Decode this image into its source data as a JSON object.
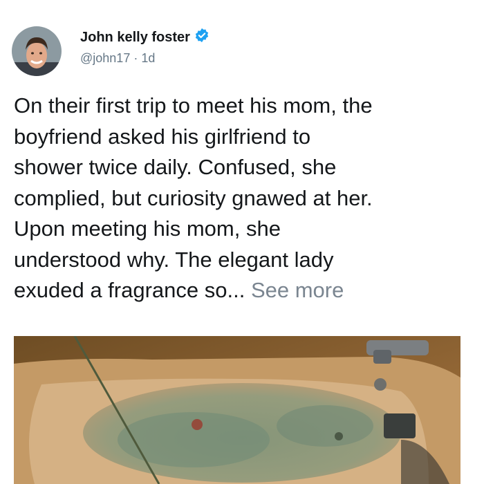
{
  "author": {
    "name": "John kelly foster",
    "handle": "@john17",
    "separator": "·",
    "time": "1d",
    "verified_icon": "verified-badge-icon"
  },
  "post": {
    "lines": [
      "On their first trip to meet his mom, the",
      "boyfriend asked his girlfriend to",
      "shower twice daily. Confused, she",
      "complied, but curiosity gnawed at her.",
      "Upon meeting his mom, she",
      "understood why. The elegant lady",
      "exuded a fragrance so..."
    ],
    "see_more": "See more"
  },
  "colors": {
    "text": "#14171a",
    "secondary": "#657786",
    "verified": "#1da1f2"
  }
}
